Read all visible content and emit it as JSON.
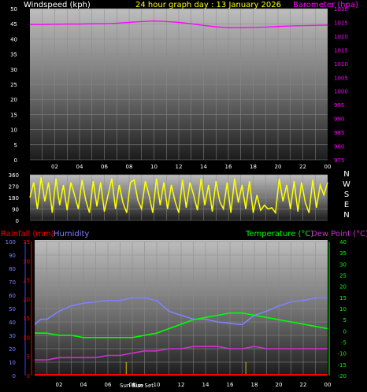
{
  "header": {
    "left": "Windspeed (kph)",
    "center": "24 hour graph day : 13 January 2026",
    "right": "Barometer (hpa)"
  },
  "bottom_header": {
    "rainfall": "Rainfall (mm)",
    "humidity": "Humidity",
    "temperature": "Temperature (°C)",
    "dewpoint": "Dew Point (°C)"
  },
  "sun_labels": {
    "rise": "Sun Rise",
    "set": "Sun Set"
  },
  "colors": {
    "windspeed": "#00ffff",
    "barometer": "#ff00ff",
    "title": "#ffff00",
    "direction": "#ffff00",
    "rainfall": "#ff0000",
    "humidity": "#8080ff",
    "temperature": "#00ff00",
    "dewpoint": "#cc33cc",
    "rain_axis": "#ff0000",
    "temp_axis": "#00ff00",
    "humid_axis": "#8080ff",
    "grid": "#8a8a8a"
  },
  "chart_data": [
    {
      "type": "line",
      "title": "24 hour graph day : 13 January 2026",
      "xlabel": "",
      "x_ticks": [
        "02",
        "04",
        "06",
        "08",
        "10",
        "12",
        "14",
        "16",
        "18",
        "20",
        "22",
        "00"
      ],
      "y_left": {
        "label": "Windspeed (kph)",
        "ticks": [
          0,
          5,
          10,
          15,
          20,
          25,
          30,
          35,
          40,
          45,
          50
        ],
        "range": [
          0,
          50
        ]
      },
      "y_right": {
        "label": "Barometer (hpa)",
        "ticks": [
          975,
          980,
          985,
          990,
          995,
          1000,
          1005,
          1010,
          1015,
          1020,
          1025,
          1030
        ],
        "range": [
          975,
          1030
        ]
      },
      "series": [
        {
          "name": "Barometer (hpa)",
          "axis": "right",
          "x": [
            0,
            1,
            2,
            3,
            4,
            5,
            6,
            7,
            8,
            9,
            10,
            11,
            12,
            13,
            14,
            15,
            16,
            17,
            18,
            19,
            20,
            21,
            22,
            23,
            24
          ],
          "values": [
            1024.2,
            1024.2,
            1024.3,
            1024.4,
            1024.4,
            1024.5,
            1024.5,
            1024.7,
            1025.0,
            1025.3,
            1025.5,
            1025.3,
            1025.0,
            1024.5,
            1023.9,
            1023.4,
            1023.1,
            1023.1,
            1023.2,
            1023.3,
            1023.5,
            1023.7,
            1023.8,
            1023.9,
            1024.0
          ]
        }
      ]
    },
    {
      "type": "line",
      "title": "",
      "y_left": {
        "label": "",
        "ticks": [
          0,
          90,
          180,
          270,
          360
        ],
        "range": [
          0,
          360
        ]
      },
      "y_right_labels": [
        "N",
        "W",
        "S",
        "E",
        "N"
      ],
      "series": [
        {
          "name": "",
          "axis": "left",
          "x": [
            0,
            0.3,
            0.6,
            0.9,
            1.2,
            1.5,
            1.8,
            2.1,
            2.4,
            2.7,
            3.0,
            3.3,
            3.6,
            3.9,
            4.2,
            4.5,
            4.8,
            5.1,
            5.4,
            5.7,
            6.0,
            6.3,
            6.6,
            6.9,
            7.2,
            7.5,
            7.8,
            8.1,
            8.4,
            8.7,
            9.0,
            9.3,
            9.6,
            9.9,
            10.2,
            10.5,
            10.8,
            11.1,
            11.4,
            11.7,
            12.0,
            12.3,
            12.6,
            12.9,
            13.2,
            13.5,
            13.8,
            14.1,
            14.4,
            14.7,
            15.0,
            15.3,
            15.6,
            15.9,
            16.2,
            16.5,
            16.8,
            17.1,
            17.4,
            17.7,
            18.0,
            18.3,
            18.6,
            18.9,
            19.2,
            19.5,
            19.8,
            20.1,
            20.4,
            20.7,
            21.0,
            21.3,
            21.6,
            21.9,
            22.2,
            22.5,
            22.8,
            23.1,
            23.4,
            23.7,
            24.0
          ],
          "values": [
            180,
            300,
            90,
            340,
            150,
            300,
            60,
            330,
            120,
            280,
            80,
            300,
            200,
            90,
            320,
            160,
            60,
            310,
            110,
            300,
            70,
            200,
            330,
            90,
            280,
            140,
            60,
            300,
            320,
            160,
            90,
            310,
            200,
            60,
            330,
            120,
            300,
            90,
            280,
            150,
            60,
            320,
            100,
            300,
            200,
            80,
            330,
            120,
            280,
            70,
            310,
            150,
            90,
            300,
            60,
            330,
            140,
            280,
            90,
            310,
            60,
            200,
            80,
            120,
            90,
            100,
            60,
            330,
            150,
            280,
            90,
            310,
            70,
            300,
            140,
            60,
            320,
            100,
            280,
            200,
            300
          ]
        }
      ]
    },
    {
      "type": "line",
      "title": "",
      "xlabel": "",
      "x_ticks": [
        "02",
        "04",
        "06",
        "08",
        "10",
        "12",
        "14",
        "16",
        "18",
        "20",
        "22",
        "00"
      ],
      "y_left_humidity": {
        "label": "Humidity",
        "ticks": [
          0,
          10,
          20,
          30,
          40,
          50,
          60,
          70,
          80,
          90,
          100
        ],
        "range": [
          0,
          100
        ]
      },
      "y_left_rain": {
        "label": "Rainfall (mm)",
        "ticks": [
          0,
          5,
          10,
          15,
          20,
          25,
          30,
          35
        ],
        "range": [
          0,
          35
        ]
      },
      "y_right": {
        "label": "Temperature (°C)",
        "ticks": [
          -20,
          -15,
          -10,
          -5,
          0,
          5,
          10,
          15,
          20,
          25,
          30,
          35,
          40
        ],
        "range": [
          -20,
          40
        ]
      },
      "series": [
        {
          "name": "Humidity",
          "axis": "humidity",
          "x": [
            0,
            0.5,
            1,
            2,
            3,
            4,
            5,
            6,
            7,
            8,
            9,
            10,
            11,
            12,
            13,
            14,
            15,
            16,
            17,
            18,
            19,
            20,
            21,
            22,
            23,
            24
          ],
          "values": [
            38,
            42,
            42,
            48,
            52,
            54,
            55,
            56,
            56,
            58,
            58,
            56,
            48,
            45,
            42,
            42,
            40,
            39,
            38,
            45,
            48,
            52,
            55,
            56,
            58,
            58
          ]
        },
        {
          "name": "Temperature (°C)",
          "axis": "right",
          "x": [
            0,
            1,
            2,
            3,
            4,
            5,
            6,
            7,
            8,
            9,
            10,
            11,
            12,
            13,
            14,
            15,
            16,
            17,
            18,
            19,
            20,
            21,
            22,
            23,
            24
          ],
          "values": [
            -1,
            -1,
            -2,
            -2,
            -3,
            -3,
            -3,
            -3,
            -3,
            -2,
            -1,
            1,
            3,
            5,
            6,
            7,
            8,
            8,
            7,
            6,
            5,
            4,
            3,
            2,
            1
          ]
        },
        {
          "name": "Dew Point (°C)",
          "axis": "right",
          "x": [
            0,
            1,
            2,
            3,
            4,
            5,
            6,
            7,
            8,
            9,
            10,
            11,
            12,
            13,
            14,
            15,
            16,
            17,
            18,
            19,
            20,
            21,
            22,
            23,
            24
          ],
          "values": [
            -13,
            -13,
            -12,
            -12,
            -12,
            -12,
            -11,
            -11,
            -10,
            -9,
            -9,
            -8,
            -8,
            -7,
            -7,
            -7,
            -8,
            -8,
            -7,
            -8,
            -8,
            -8,
            -8,
            -8,
            -8
          ]
        },
        {
          "name": "Rainfall (mm)",
          "axis": "rain",
          "x": [
            0,
            24
          ],
          "values": [
            0,
            0
          ]
        }
      ],
      "markers": {
        "sunrise_hour": 7.5,
        "sunset_hour": 17.3
      }
    }
  ]
}
